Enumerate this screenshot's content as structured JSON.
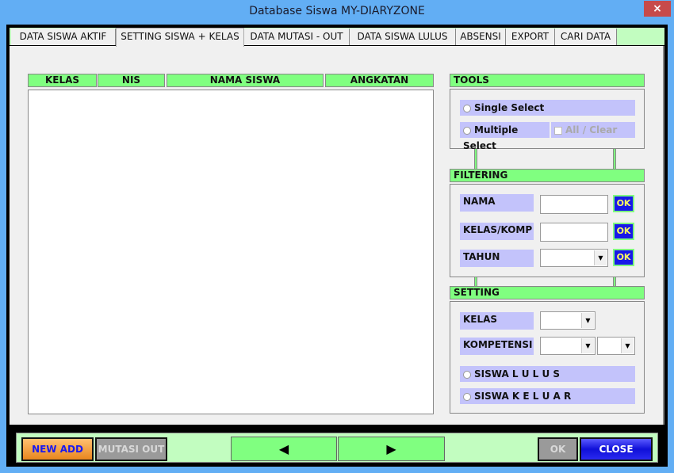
{
  "window": {
    "title": "Database Siswa MY-DIARYZONE",
    "close_glyph": "×"
  },
  "tabs": [
    {
      "label": "DATA SISWA AKTIF"
    },
    {
      "label": "SETTING SISWA + KELAS",
      "active": true
    },
    {
      "label": "DATA MUTASI - OUT"
    },
    {
      "label": "DATA SISWA LULUS"
    },
    {
      "label": "ABSENSI"
    },
    {
      "label": "EXPORT"
    },
    {
      "label": "CARI DATA"
    }
  ],
  "list": {
    "columns": [
      "KELAS",
      "NIS",
      "NAMA SISWA",
      "ANGKATAN"
    ],
    "rows": []
  },
  "tools": {
    "header": "TOOLS",
    "single_select": "Single Select",
    "multiple_select": "Multiple Select",
    "all_clear": "All / Clear"
  },
  "filtering": {
    "header": "FILTERING",
    "nama_label": "NAMA",
    "nama_value": "",
    "kelas_komp_label": "KELAS/KOMP",
    "kelas_komp_value": "",
    "tahun_label": "TAHUN",
    "tahun_value": "",
    "ok_label": "OK"
  },
  "setting": {
    "header": "SETTING",
    "kelas_label": "KELAS",
    "kelas_value": "",
    "kompetensi_label": "KOMPETENSI",
    "kompetensi_value": "",
    "kompetensi_value2": "",
    "siswa_lulus": "SISWA L U L U S",
    "siswa_keluar": "SISWA K E L U A R"
  },
  "bottom": {
    "new_add": "NEW ADD",
    "mutasi_out": "MUTASI OUT",
    "prev_glyph": "◀",
    "next_glyph": "▶",
    "ok": "OK",
    "close": "CLOSE"
  },
  "colors": {
    "accent_green": "#80ff80",
    "light_green": "#c2fdc0",
    "label_lavender": "#c3c3fb",
    "button_blue": "#1818e8",
    "button_orange": "#f59a3c",
    "titlebar_blue": "#62aef4",
    "close_red": "#c74a4a"
  }
}
